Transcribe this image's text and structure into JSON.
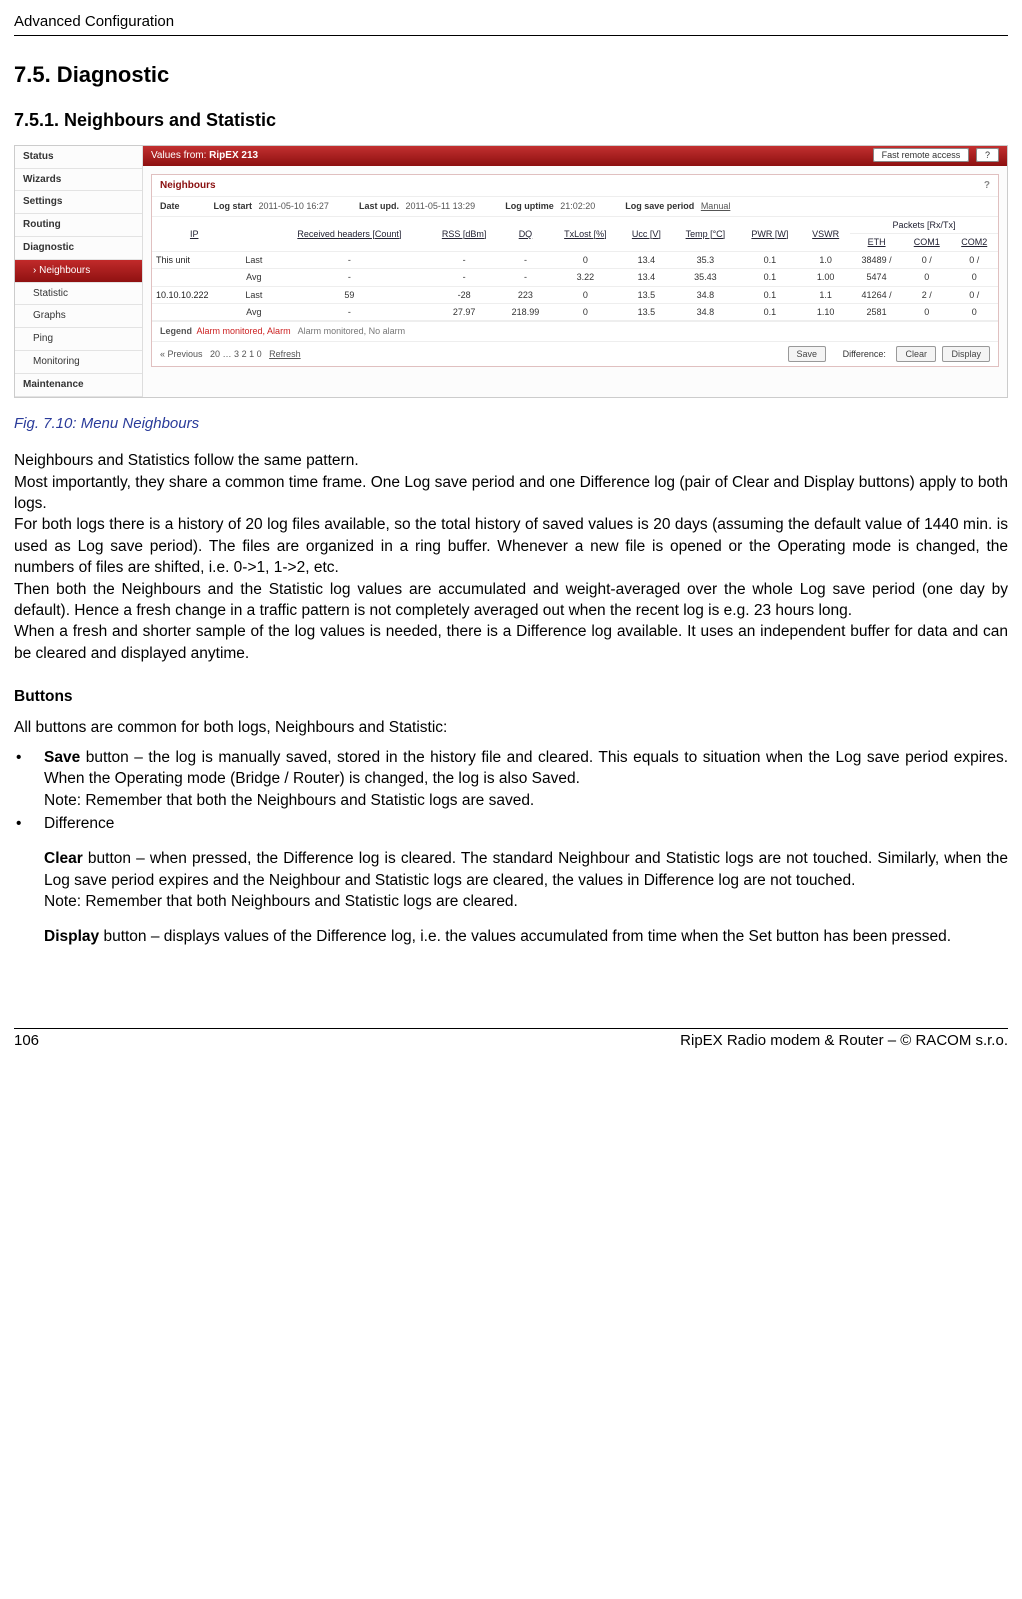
{
  "page": {
    "header": "Advanced Configuration",
    "h2": "7.5. Diagnostic",
    "h3": "7.5.1. Neighbours and Statistic",
    "figcap": "Fig. 7.10: Menu Neighbours",
    "footer_left": "106",
    "footer_right": "RipEX Radio modem & Router – © RACOM s.r.o."
  },
  "sidebar": {
    "items": [
      "Status",
      "Wizards",
      "Settings",
      "Routing",
      "Diagnostic",
      "Neighbours",
      "Statistic",
      "Graphs",
      "Ping",
      "Monitoring",
      "Maintenance"
    ],
    "active_index": 5,
    "sub_start_index": 5,
    "sub_end_index": 9
  },
  "redbar": {
    "prefix": "Values from:",
    "device": "RipEX 213",
    "fast_remote": "Fast remote access",
    "help": "?"
  },
  "panel": {
    "title": "Neighbours",
    "help": "?",
    "meta": {
      "date_label": "Date",
      "logstart_label": "Log start",
      "logstart_value": "2011-05-10 16:27",
      "lastupd_label": "Last upd.",
      "lastupd_value": "2011-05-11 13:29",
      "loguptime_label": "Log uptime",
      "loguptime_value": "21:02:20",
      "logsave_label": "Log save period",
      "logsave_value": "Manual"
    },
    "columns": {
      "ip": "IP",
      "recv": "Received headers [Count]",
      "rss": "RSS [dBm]",
      "dq": "DQ",
      "txlost": "TxLost [%]",
      "ucc": "Ucc [V]",
      "temp": "Temp [°C]",
      "pwr": "PWR [W]",
      "vswr": "VSWR",
      "packets": "Packets [Rx/Tx]",
      "eth": "ETH",
      "com1": "COM1",
      "com2": "COM2"
    },
    "rows": [
      {
        "ipcell": "This unit",
        "sub": "Last",
        "recv": "-",
        "rss": "-",
        "dq": "-",
        "txlost": "0",
        "ucc": "13.4",
        "temp": "35.3",
        "pwr": "0.1",
        "vswr": "1.0",
        "eth": "38489 /",
        "com1": "0 /",
        "com2": "0 /"
      },
      {
        "ipcell": "",
        "sub": "Avg",
        "recv": "-",
        "rss": "-",
        "dq": "-",
        "txlost": "3.22",
        "ucc": "13.4",
        "temp": "35.43",
        "pwr": "0.1",
        "vswr": "1.00",
        "eth": "5474",
        "com1": "0",
        "com2": "0"
      },
      {
        "ipcell": "10.10.10.222",
        "sub": "Last",
        "recv": "59",
        "rss": "-28",
        "dq": "223",
        "txlost": "0",
        "ucc": "13.5",
        "temp": "34.8",
        "pwr": "0.1",
        "vswr": "1.1",
        "eth": "41264 /",
        "com1": "2 /",
        "com2": "0 /"
      },
      {
        "ipcell": "",
        "sub": "Avg",
        "recv": "-",
        "rss": "27.97",
        "dq": "218.99",
        "txlost": "0",
        "ucc": "13.5",
        "temp": "34.8",
        "pwr": "0.1",
        "vswr": "1.10",
        "eth": "2581",
        "com1": "0",
        "com2": "0"
      }
    ],
    "legend": {
      "label": "Legend",
      "a1": "Alarm monitored, Alarm",
      "a2": "Alarm monitored, No alarm"
    },
    "footctrl": {
      "prev": "« Previous",
      "pages": "20 … 3 2 1 0",
      "refresh": "Refresh",
      "save": "Save",
      "diff_label": "Difference:",
      "clear": "Clear",
      "display": "Display"
    }
  },
  "body": {
    "p1": "Neighbours and Statistics follow the same pattern.",
    "p2": "Most importantly, they share a common time frame. One Log save period and one Difference log (pair of Clear and Display buttons) apply to both logs.",
    "p3": "For both logs there is a history of 20 log files available, so the total history of saved values is 20 days (assuming the default value of 1440 min. is used as Log save period). The files are organized in a ring buffer. Whenever a new file is opened or the Operating mode is changed, the numbers of files are shifted, i.e. 0->1, 1->2, etc.",
    "p4": "Then both the Neighbours and the Statistic log values are accumulated and weight-averaged over the whole Log save period (one day by default). Hence a fresh change in a traffic pattern is not completely averaged out when the recent log is e.g. 23 hours long.",
    "p5": "When a fresh and shorter sample of the log values is needed, there is a Difference log available. It uses an independent buffer for data and can be cleared and displayed anytime.",
    "buttons_head": "Buttons",
    "buttons_intro": "All buttons are common for both logs, Neighbours and Statistic:",
    "li1_strong": "Save",
    "li1_rest": " button – the log is manually saved, stored in the history file and cleared. This equals to situation when the Log save period expires. When the Operating mode (Bridge / Router) is changed, the log is also Saved.",
    "li1_note": "Note: Remember that both the Neighbours and Statistic logs are saved.",
    "li2_label": "Difference",
    "li2_clear_strong": "Clear",
    "li2_clear_rest": " button – when pressed, the Difference log is cleared. The standard Neighbour and Statistic logs are not touched. Similarly, when the Log save period expires and the Neighbour and Statistic logs are cleared, the values in Difference log are not touched.",
    "li2_clear_note": "Note: Remember that both Neighbours and Statistic logs are cleared.",
    "li2_display_strong": "Display",
    "li2_display_rest": " button – displays values of the Difference log, i.e. the values accumulated from time when the Set button has been pressed."
  }
}
